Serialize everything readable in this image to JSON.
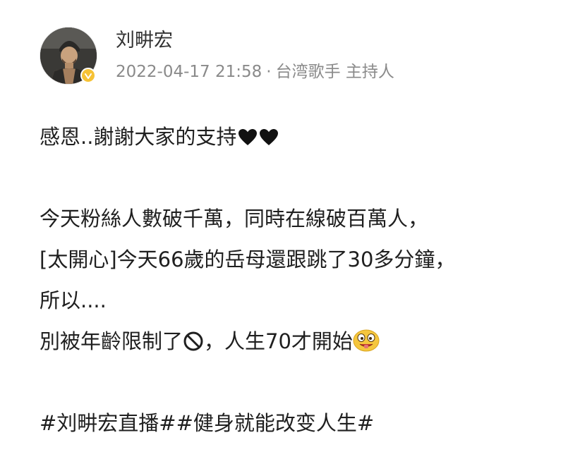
{
  "author": {
    "name": "刘畊宏",
    "timestamp": "2022-04-17 21:58",
    "separator": "·",
    "tag": "台湾歌手 主持人",
    "verified_badge_color": "#f6c235"
  },
  "post": {
    "line1_text": "感恩..謝謝大家的支持",
    "line1_emojis": [
      "black-heart-icon",
      "black-heart-icon"
    ],
    "line2": "今天粉絲人數破千萬，同時在線破百萬人，",
    "line3": "[太開心]今天66歲的岳母還跟跳了30多分鐘，",
    "line4": "所以....",
    "line5_part1": "別被年齡限制了",
    "line5_part2": "，人生70才開始",
    "line5_icons": [
      "no-entry-icon",
      "silly-face-emoji-icon"
    ],
    "hashtags": "#刘畊宏直播##健身就能改变人生#"
  },
  "colors": {
    "text": "#1f1f1f",
    "meta": "#8a8a8a",
    "name": "#333333",
    "emoji_yellow": "#f5c63d"
  }
}
